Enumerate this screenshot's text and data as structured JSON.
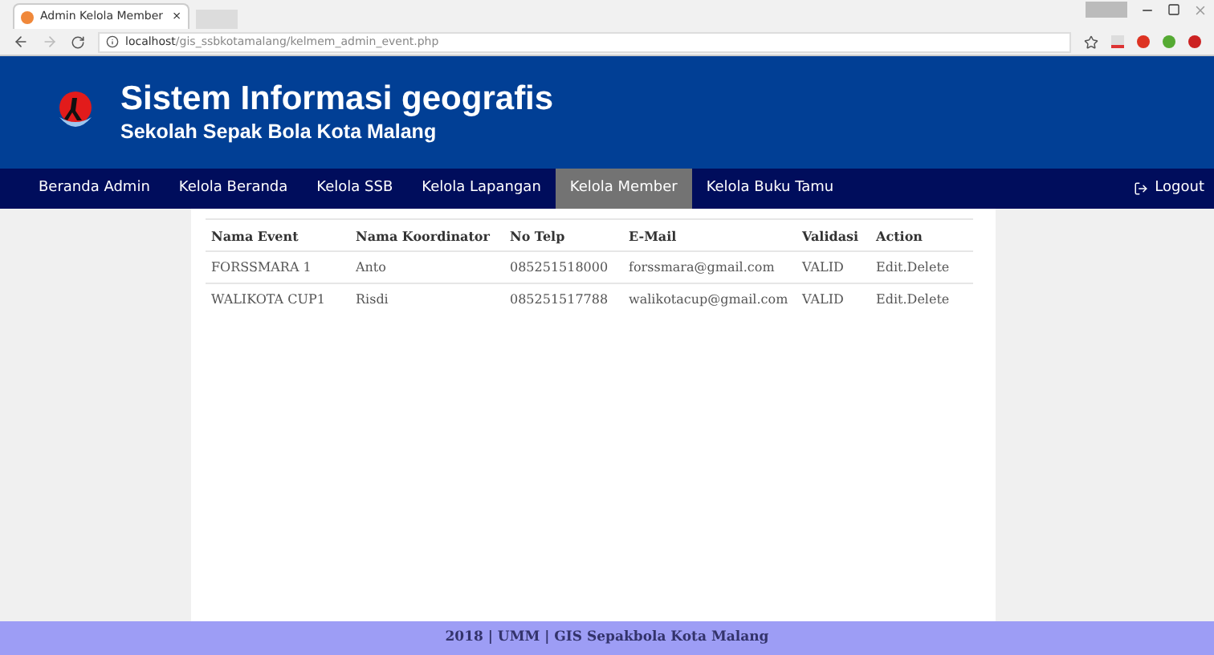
{
  "browser": {
    "tab_title": "Admin Kelola Member",
    "tab_close": "×",
    "url_host": "localhost",
    "url_path": "/gis_ssbkotamalang/kelmem_admin_event.php"
  },
  "header": {
    "title": "Sistem Informasi geografis",
    "subtitle": "Sekolah Sepak Bola Kota Malang"
  },
  "nav": {
    "items": [
      {
        "label": "Beranda Admin",
        "selected": false
      },
      {
        "label": "Kelola Beranda",
        "selected": false
      },
      {
        "label": "Kelola SSB",
        "selected": false
      },
      {
        "label": "Kelola Lapangan",
        "selected": false
      },
      {
        "label": "Kelola Member",
        "selected": true
      },
      {
        "label": "Kelola Buku Tamu",
        "selected": false
      }
    ],
    "logout": "Logout"
  },
  "table": {
    "columns": [
      "Nama Event",
      "Nama Koordinator",
      "No Telp",
      "E-Mail",
      "Validasi",
      "Action"
    ],
    "rows": [
      [
        "FORSSMARA 1",
        "Anto",
        "085251518000",
        "forssmara@gmail.com",
        "VALID",
        "Edit.Delete"
      ],
      [
        "WALIKOTA CUP1",
        "Risdi",
        "085251517788",
        "walikotacup@gmail.com",
        "VALID",
        "Edit.Delete"
      ]
    ]
  },
  "footer": "2018 | UMM | GIS Sepakbola Kota Malang"
}
